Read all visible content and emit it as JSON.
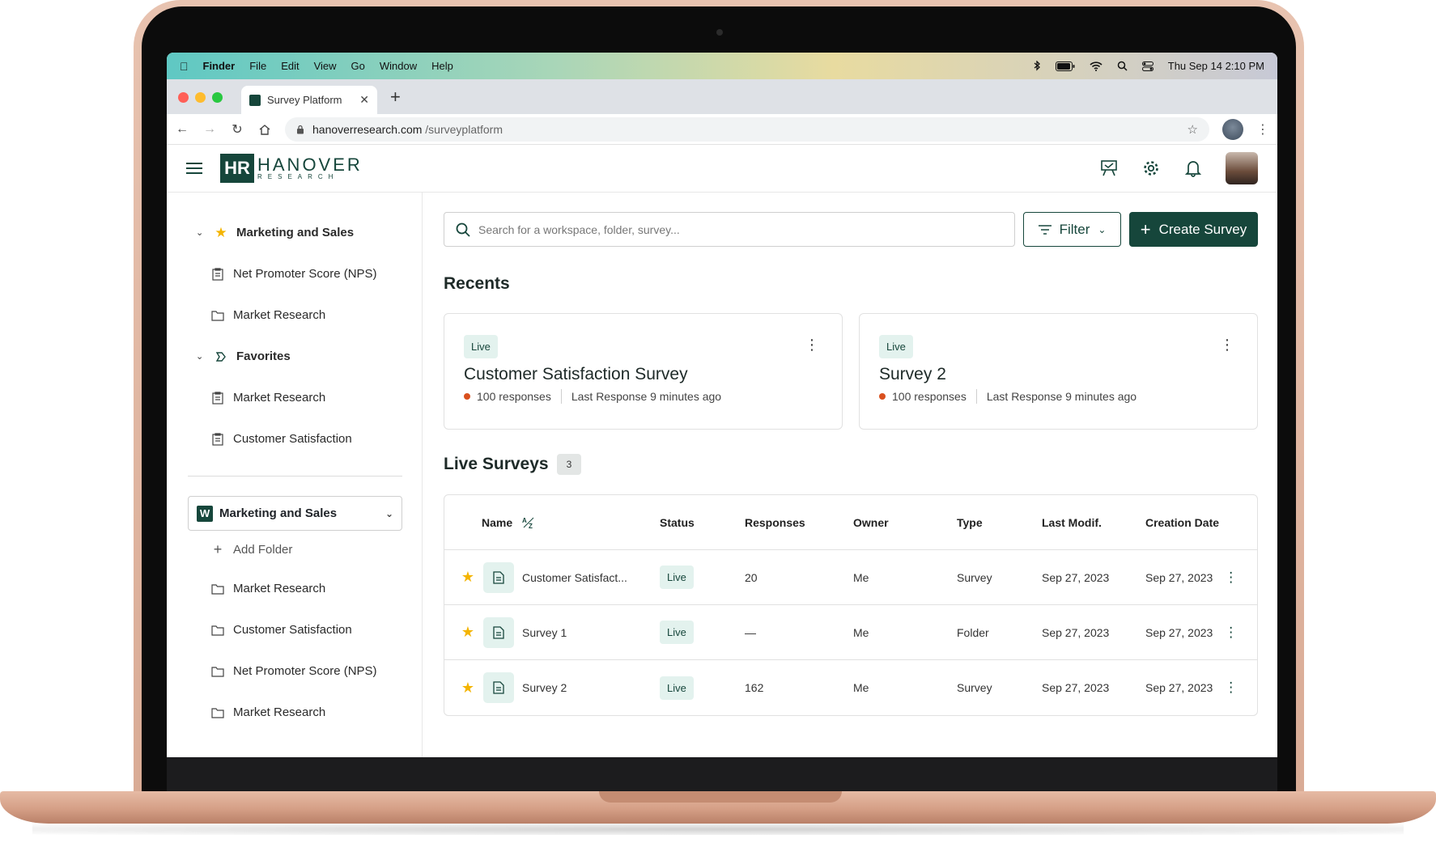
{
  "menubar": {
    "app": "Finder",
    "items": [
      "File",
      "Edit",
      "View",
      "Go",
      "Window",
      "Help"
    ],
    "datetime": "Thu Sep 14  2:10 PM"
  },
  "browser": {
    "tab_title": "Survey Platform",
    "url_host": "hanoverresearch.com",
    "url_path": "/surveyplatform"
  },
  "app": {
    "logo_main": "HANOVER",
    "logo_sub": "RESEARCH",
    "logo_mark": "HR",
    "colors": {
      "primary": "#16463b",
      "live_bg": "#e3f2ee",
      "accent_dot": "#d9501e",
      "star": "#f4b400"
    }
  },
  "sidebar": {
    "groups": [
      {
        "label": "Marketing and Sales",
        "icon": "star-icon",
        "children": [
          {
            "label": "Net Promoter Score (NPS)",
            "icon": "survey-icon"
          },
          {
            "label": "Market Research",
            "icon": "folder-icon"
          }
        ]
      },
      {
        "label": "Favorites",
        "icon": "tag-icon",
        "children": [
          {
            "label": "Market Research",
            "icon": "survey-icon"
          },
          {
            "label": "Customer Satisfaction",
            "icon": "survey-icon"
          }
        ]
      }
    ],
    "workspace": {
      "badge": "W",
      "label": "Marketing and Sales"
    },
    "add_folder": "Add Folder",
    "folders": [
      "Market Research",
      "Customer Satisfaction",
      "Net Promoter Score (NPS)",
      "Market Research"
    ]
  },
  "main": {
    "search_placeholder": "Search for a workspace, folder, survey...",
    "filter_label": "Filter",
    "create_label": "Create Survey",
    "recents_title": "Recents",
    "recents": [
      {
        "status": "Live",
        "title": "Customer Satisfaction Survey",
        "responses": "100 responses",
        "last": "Last Response 9 minutes ago"
      },
      {
        "status": "Live",
        "title": "Survey 2",
        "responses": "100 responses",
        "last": "Last Response 9 minutes ago"
      }
    ],
    "live_title": "Live Surveys",
    "live_count": "3",
    "columns": [
      "Name",
      "Status",
      "Responses",
      "Owner",
      "Type",
      "Last Modif.",
      "Creation Date"
    ],
    "rows": [
      {
        "name": "Customer Satisfact...",
        "status": "Live",
        "responses": "20",
        "owner": "Me",
        "type": "Survey",
        "modified": "Sep 27, 2023",
        "created": "Sep 27, 2023"
      },
      {
        "name": "Survey 1",
        "status": "Live",
        "responses": "—",
        "owner": "Me",
        "type": "Folder",
        "modified": "Sep 27, 2023",
        "created": "Sep 27, 2023"
      },
      {
        "name": "Survey 2",
        "status": "Live",
        "responses": "162",
        "owner": "Me",
        "type": "Survey",
        "modified": "Sep 27, 2023",
        "created": "Sep 27, 2023"
      }
    ]
  }
}
